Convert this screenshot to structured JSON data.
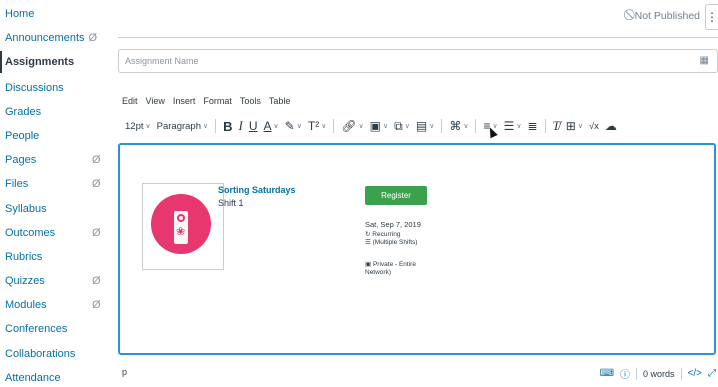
{
  "nav": {
    "items": [
      {
        "label": "Home"
      },
      {
        "label": "Announcements"
      },
      {
        "label": "Assignments"
      },
      {
        "label": "Discussions"
      },
      {
        "label": "Grades"
      },
      {
        "label": "People"
      },
      {
        "label": "Pages"
      },
      {
        "label": "Files"
      },
      {
        "label": "Syllabus"
      },
      {
        "label": "Outcomes"
      },
      {
        "label": "Rubrics"
      },
      {
        "label": "Quizzes"
      },
      {
        "label": "Modules"
      },
      {
        "label": "Conferences"
      },
      {
        "label": "Collaborations"
      },
      {
        "label": "Attendance"
      }
    ],
    "hidden_glyph": "Ø"
  },
  "header": {
    "status": "Not Published",
    "status_icon": "⃠"
  },
  "form": {
    "assignment_name_placeholder": "Assignment Name"
  },
  "editor": {
    "menu": [
      "Edit",
      "View",
      "Insert",
      "Format",
      "Tools",
      "Table"
    ],
    "font_size": "12pt",
    "block_format": "Paragraph",
    "content": {
      "event_title": "Sorting Saturdays",
      "event_subtitle": "Shift 1",
      "register_label": "Register",
      "date": "Sat, Sep 7, 2019",
      "recurring": "Recurring",
      "multiple_shifts": "(Multiple Shifts)",
      "privacy": "Private - Entire Network)"
    },
    "statusbar": {
      "path": "p",
      "word_count": "0 words",
      "code_label": "</>"
    }
  },
  "colors": {
    "link": "#0770a3",
    "accent_border": "#2a92d6",
    "register_green": "#3ca14d",
    "logo_pink": "#e8366e"
  }
}
